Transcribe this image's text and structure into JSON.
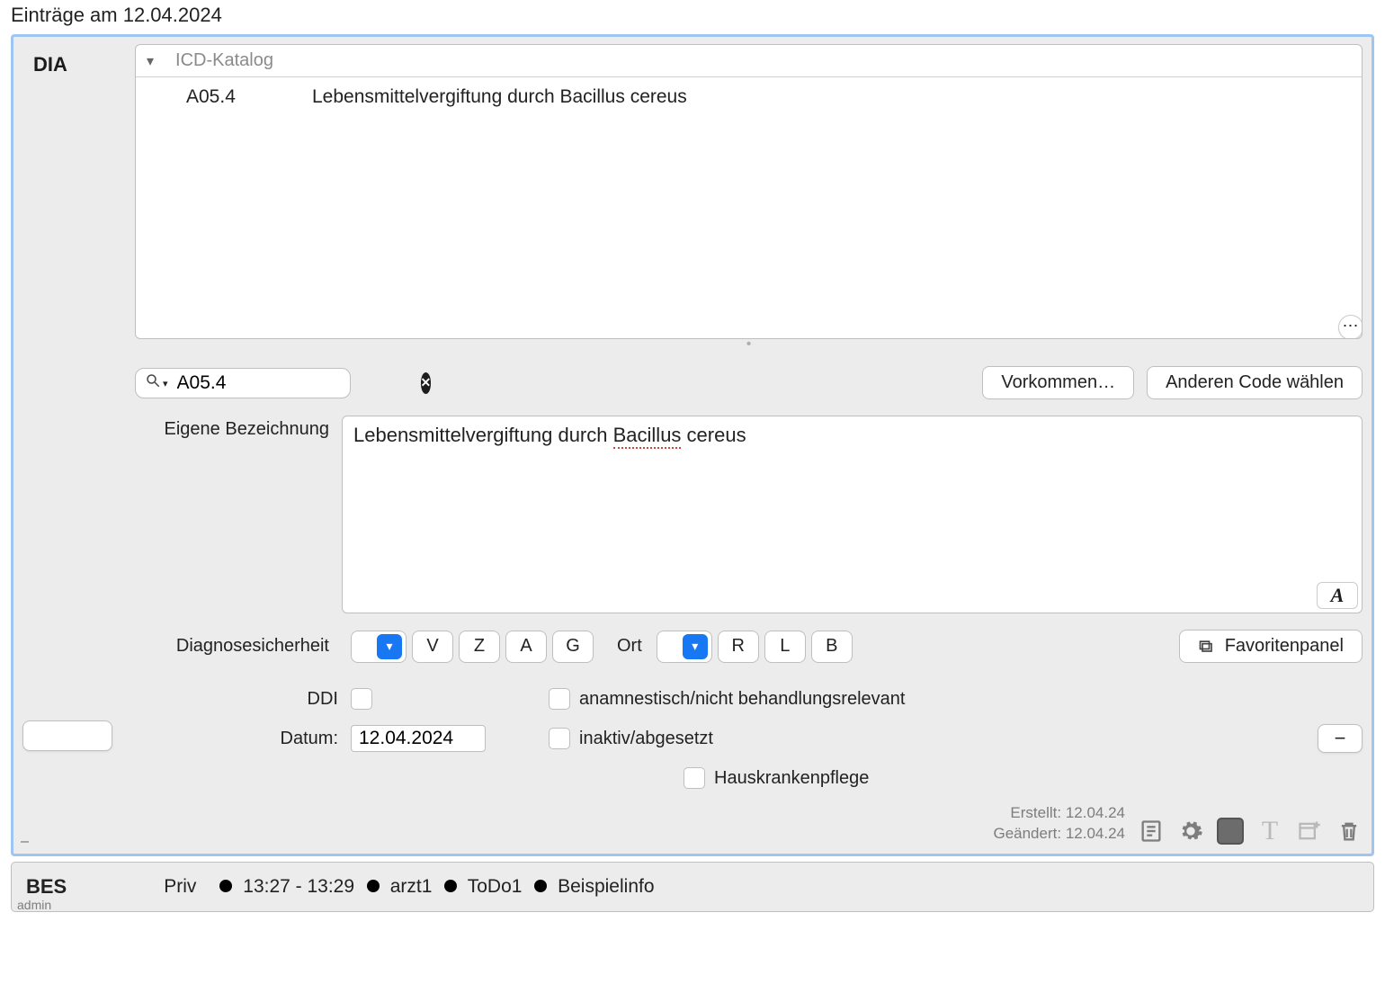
{
  "page_title": "Einträge am 12.04.2024",
  "sidebar_tag": "DIA",
  "catalog": {
    "header_label": "ICD-Katalog",
    "row": {
      "code": "A05.4",
      "text": "Lebensmittelvergiftung durch Bacillus cereus"
    }
  },
  "search_value": "A05.4",
  "buttons": {
    "vorkommen": "Vorkommen…",
    "anderen_code": "Anderen Code wählen",
    "favoritenpanel": "Favoritenpanel"
  },
  "description": {
    "label": "Eigene Bezeichnung",
    "parts": {
      "pre": "Lebensmittelvergiftung durch ",
      "spell": "Bacillus",
      "post": " cereus"
    }
  },
  "diag_security": {
    "label": "Diagnosesicherheit",
    "chips": [
      "V",
      "Z",
      "A",
      "G"
    ]
  },
  "ort": {
    "label": "Ort",
    "chips": [
      "R",
      "L",
      "B"
    ]
  },
  "ddi_label": "DDI",
  "datum_label": "Datum:",
  "datum_value": "12.04.2024",
  "checks": {
    "anamnestisch": "anamnestisch/nicht behandlungsrelevant",
    "inaktiv": "inaktiv/abgesetzt",
    "hauskrankenpflege": "Hauskrankenpflege"
  },
  "meta": {
    "erstellt_label": "Erstellt:",
    "erstellt_value": "12.04.24",
    "geaendert_label": "Geändert:",
    "geaendert_value": "12.04.24"
  },
  "bottom": {
    "tag": "BES",
    "admin": "admin",
    "priv": "Priv",
    "time_range": "13:27 - 13:29",
    "user": "arzt1",
    "todo": "ToDo1",
    "info": "Beispielinfo"
  }
}
